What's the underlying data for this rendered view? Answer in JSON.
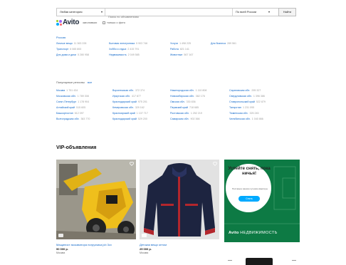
{
  "search": {
    "category": "Любая категория",
    "query_placeholder": "Поиск по объявлениям",
    "region": "По всей России",
    "find_label": "Найти",
    "only_titles": "заголовках",
    "only_photo": "только с фото"
  },
  "logo": {
    "text": "Avito"
  },
  "categories": {
    "region_heading": "Россия",
    "columns": [
      [
        {
          "label": "Личные вещи",
          "count": "11 363 228"
        },
        {
          "label": "Транспорт",
          "count": "6 065 800"
        },
        {
          "label": "Для дома и дачи",
          "count": "5 280 958"
        }
      ],
      [
        {
          "label": "Бытовая электроника",
          "count": "5 903 746"
        },
        {
          "label": "Хобби и отдых",
          "count": "2 415 791"
        },
        {
          "label": "Недвижимость",
          "count": "2 049 585"
        }
      ],
      [
        {
          "label": "Услуги",
          "count": "1 498 225"
        },
        {
          "label": "Работа",
          "count": "821 141"
        },
        {
          "label": "Животные",
          "count": "567 167"
        }
      ],
      [
        {
          "label": "Для бизнеса",
          "count": "289 561"
        }
      ]
    ]
  },
  "cities": {
    "heading": "Популярные регионы",
    "all_label": "все",
    "columns": [
      [
        {
          "label": "Москва",
          "count": "1 751 434"
        },
        {
          "label": "Московская обл.",
          "count": "1 789 308"
        },
        {
          "label": "Санкт-Петербург",
          "count": "1 178 904"
        },
        {
          "label": "Алтайский край",
          "count": "515 605"
        },
        {
          "label": "Башкортостан",
          "count": "612 097"
        },
        {
          "label": "Волгоградская обл.",
          "count": "363 770"
        }
      ],
      [
        {
          "label": "Воронежская обл.",
          "count": "372 374"
        },
        {
          "label": "Иркутская обл.",
          "count": "417 877"
        },
        {
          "label": "Краснодарский край",
          "count": "975 201"
        },
        {
          "label": "Кемеровская обл.",
          "count": "329 162"
        },
        {
          "label": "Красноярский край",
          "count": "1 107 717"
        },
        {
          "label": "Краснодарский край",
          "count": "529 200"
        }
      ],
      [
        {
          "label": "Нижегородская обл.",
          "count": "1 110 808"
        },
        {
          "label": "Новосибирская обл.",
          "count": "382 176"
        },
        {
          "label": "Омская обл.",
          "count": "330 836"
        },
        {
          "label": "Пермский край",
          "count": "718 685"
        },
        {
          "label": "Ростовская обл.",
          "count": "1 252 219"
        },
        {
          "label": "Самарская обл.",
          "count": "902 366"
        }
      ],
      [
        {
          "label": "Саратовская обл.",
          "count": "295 327"
        },
        {
          "label": "Свердловская обл.",
          "count": "1 396 386"
        },
        {
          "label": "Ставропольский край",
          "count": "522 879"
        },
        {
          "label": "Татарстан",
          "count": "1 231 095"
        },
        {
          "label": "Тюменская обл.",
          "count": "325 245"
        },
        {
          "label": "Челябинская обл.",
          "count": "1 040 866"
        }
      ]
    ]
  },
  "vip": {
    "title": "VIP-объявления",
    "cards": [
      {
        "title": "Мащинист экскаватора погрузчика jcb 3cx",
        "price": "90 000 р.",
        "location": "Москва"
      },
      {
        "title": "Детская вещи оптом",
        "price": "25 000 р.",
        "location": "Москва"
      }
    ]
  },
  "ad": {
    "headline": "Успейте снять, пока ничья!",
    "sub": "Поставьте вашим лучшим квартиры",
    "button": "Снять",
    "brand": "Avito",
    "brand_rest": "НЕДВИЖИМОСТЬ"
  },
  "colors": {
    "link": "#0e66c9",
    "ad_bg": "#0d7a44",
    "ad_button": "#00aaff"
  }
}
